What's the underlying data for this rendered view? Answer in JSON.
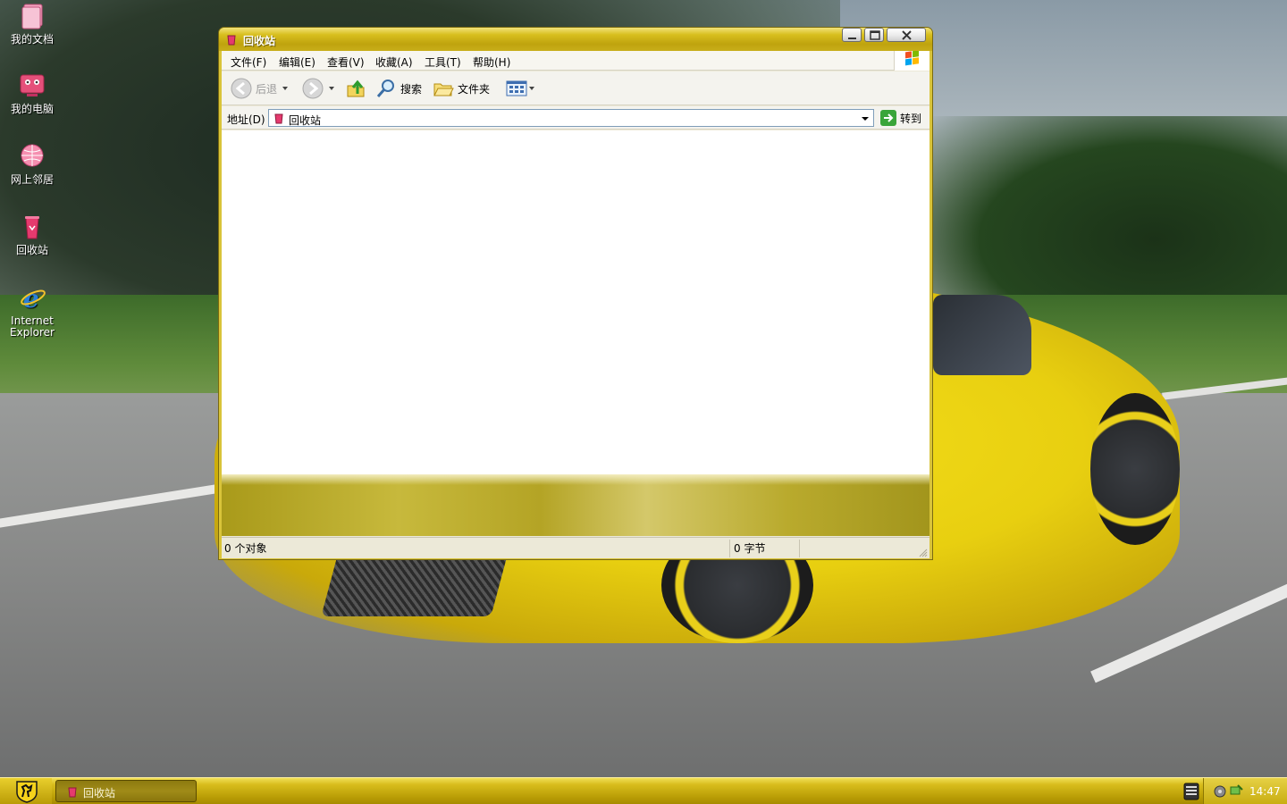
{
  "desktop": {
    "icons": [
      {
        "label": "我的文档",
        "icon": "my-documents-icon"
      },
      {
        "label": "我的电脑",
        "icon": "my-computer-icon"
      },
      {
        "label": "网上邻居",
        "icon": "network-places-icon"
      },
      {
        "label": "回收站",
        "icon": "recycle-bin-icon"
      },
      {
        "label": "Internet Explorer",
        "icon": "internet-explorer-icon"
      }
    ]
  },
  "window": {
    "title": "回收站",
    "menu": [
      "文件(F)",
      "编辑(E)",
      "查看(V)",
      "收藏(A)",
      "工具(T)",
      "帮助(H)"
    ],
    "toolbar": {
      "back_label": "后退",
      "search_label": "搜索",
      "folders_label": "文件夹"
    },
    "address": {
      "label": "地址(D)",
      "value": "回收站",
      "go_label": "转到"
    },
    "status": {
      "objects": "0 个对象",
      "size": "0 字节"
    }
  },
  "taskbar": {
    "task_label": "回收站",
    "clock": "14:47"
  },
  "colors": {
    "theme_gold": "#d8bf1e",
    "task_button": "#8d7a10",
    "address_border": "#7f9db9"
  }
}
